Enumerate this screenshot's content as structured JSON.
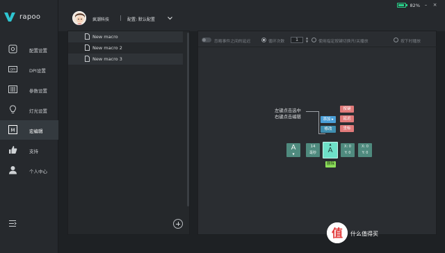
{
  "brand": {
    "name": "rapoo",
    "accent": "#2ec4b6"
  },
  "nav": {
    "items": [
      {
        "label": "配置设置",
        "icon": "settings-icon"
      },
      {
        "label": "DPI设置",
        "icon": "dpi-icon"
      },
      {
        "label": "参数设置",
        "icon": "sliders-icon"
      },
      {
        "label": "灯光设置",
        "icon": "bulb-icon"
      },
      {
        "label": "宏编辑",
        "icon": "macro-icon",
        "active": true
      },
      {
        "label": "支持",
        "icon": "thumbs-up-icon"
      },
      {
        "label": "个人中心",
        "icon": "user-icon"
      }
    ],
    "bottom_icon": "menu-collapse-icon"
  },
  "header": {
    "username": "疯潮科技",
    "config_label": "配置: 默认配置",
    "battery": "82%",
    "status_color": "#28d28a"
  },
  "macro_list": {
    "items": [
      "New macro",
      "New macro 2",
      "New macro 3"
    ],
    "selected_index": 0
  },
  "toolbar": {
    "ignore_delay": "忽略事件之间的延迟",
    "loop_count_label": "循环次数",
    "loop_count_value": "1",
    "toggle_mode": "使用指定按键切换开/关播放",
    "hold_mode": "按下时播放"
  },
  "diagram": {
    "hint_line1": "左键点击选中",
    "hint_line2": "右键点击编辑",
    "menu_add": "添加",
    "menu_modify": "修改",
    "menu_key": "按键",
    "menu_delay": "延迟",
    "menu_coord": "坐标",
    "key_a": "A",
    "delay_value": "14",
    "delay_unit": "毫秒",
    "coord1_x": "X: 0",
    "coord1_y": "Y: 0",
    "coord2_x": "X: 0",
    "coord2_y": "Y: 0",
    "delete": "删除"
  },
  "watermark": {
    "text": "什么值得买"
  }
}
